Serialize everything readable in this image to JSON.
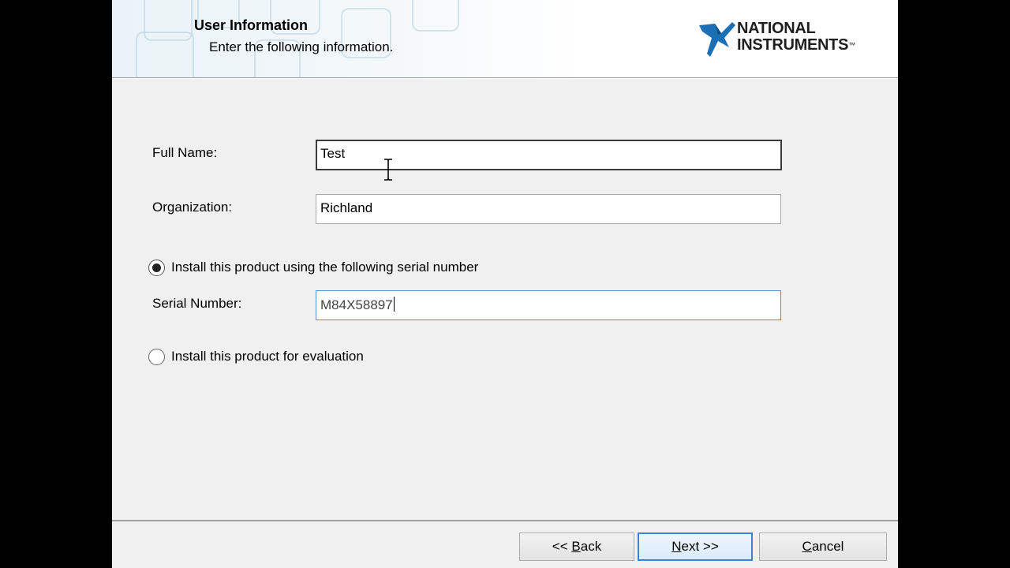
{
  "header": {
    "title": "User Information",
    "subtitle": "Enter the following information.",
    "logo": {
      "line1": "NATIONAL",
      "line2": "INSTRUMENTS",
      "trademark": "™",
      "icon": "ni-eagle-logo-icon",
      "brand_color": "#1a6fb5"
    }
  },
  "form": {
    "full_name": {
      "label": "Full Name:",
      "value": "Test"
    },
    "organization": {
      "label": "Organization:",
      "value": "Richland"
    },
    "serial_option": {
      "label": "Install this product using the following serial number",
      "selected": true
    },
    "serial_number": {
      "label": "Serial Number:",
      "value": "M84X58897"
    },
    "evaluation_option": {
      "label": "Install this product for evaluation",
      "selected": false
    }
  },
  "footer": {
    "back_button": {
      "prefix": "<< ",
      "mnemonic": "B",
      "rest": "ack"
    },
    "next_button": {
      "mnemonic": "N",
      "rest": "ext >>"
    },
    "cancel_button": {
      "mnemonic": "C",
      "rest": "ancel"
    }
  },
  "colors": {
    "dialog_bg": "#f0f0f0",
    "accent": "#3c7fd6"
  }
}
